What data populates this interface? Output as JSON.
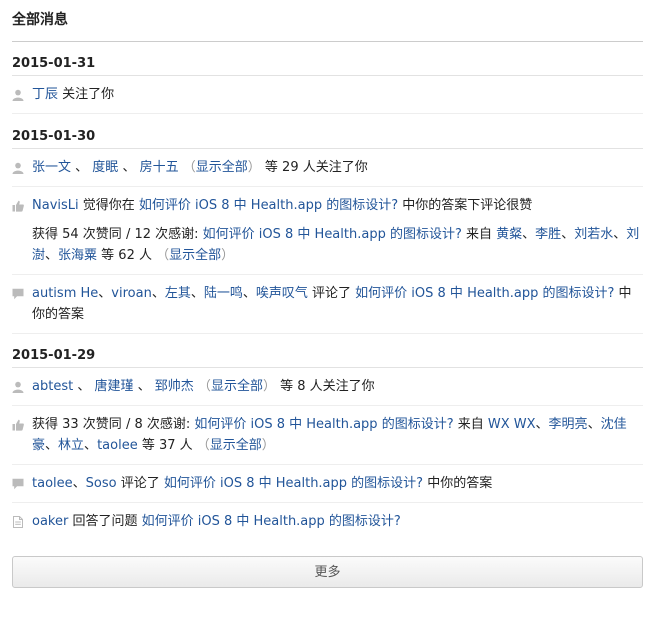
{
  "header": {
    "title": "全部消息"
  },
  "groups": {
    "g1": {
      "date": "2015-01-31",
      "item1": {
        "user": "丁辰",
        "action": " 关注了你"
      }
    },
    "g2": {
      "date": "2015-01-30",
      "item1": {
        "u1": "张一文",
        "sep1": " 、",
        "u2": "度眠",
        "sep2": " 、",
        "u3": "房十五",
        "show_all": "显示全部",
        "rest": " 等 29 人关注了你"
      },
      "item2": {
        "user": "NavisLi",
        "t1": " 觉得你在 ",
        "question": "如何评价 iOS 8 中 Health.app 的图标设计?",
        "t2": "  中你的答案下评论很赞"
      },
      "item3": {
        "t1": "获得 54 次赞同 / 12 次感谢: ",
        "question": "如何评价 iOS 8 中 Health.app 的图标设计?",
        "t2": "  来自 ",
        "u1": "黄粲",
        "u2": "李胜",
        "u3": "刘若水",
        "u4": "刘澍",
        "u5": "张海粟",
        "sep": "、",
        "t3": " 等 62 人 ",
        "show_all": "显示全部"
      },
      "item4": {
        "u1": "autism He",
        "u2": "viroan",
        "u3": "左其",
        "u4": "陆一鸣",
        "u5": "唉声叹气",
        "sep": "、",
        "t1": " 评论了 ",
        "question": "如何评价 iOS 8 中 Health.app 的图标设计?",
        "t2": "  中你的答案"
      }
    },
    "g3": {
      "date": "2015-01-29",
      "item1": {
        "u1": "abtest",
        "sep1": " 、",
        "u2": "唐建瑾",
        "sep2": " 、",
        "u3": "郅帅杰",
        "show_all": "显示全部",
        "rest": " 等 8 人关注了你"
      },
      "item2": {
        "t1": "获得 33 次赞同 / 8 次感谢: ",
        "question": "如何评价 iOS 8 中 Health.app 的图标设计?",
        "t2": "  来自 ",
        "u1": "WX WX",
        "u2": "李明亮",
        "u3": "沈佳豪",
        "u4": "林立",
        "u5": "taolee",
        "sep": "、",
        "t3": " 等 37 人 ",
        "show_all": "显示全部"
      },
      "item3": {
        "u1": "taolee",
        "u2": "Soso",
        "sep": "、",
        "t1": " 评论了 ",
        "question": "如何评价 iOS 8 中 Health.app 的图标设计?",
        "t2": "  中你的答案"
      },
      "item4": {
        "user": "oaker",
        "t1": " 回答了问题 ",
        "question": "如何评价 iOS 8 中 Health.app 的图标设计?"
      }
    }
  },
  "paren_open": "（",
  "paren_close": "）",
  "more_button": {
    "label": "更多"
  },
  "icons": {
    "user": "user-icon",
    "thumb": "thumbs-up-icon",
    "comment": "comment-icon",
    "doc": "document-icon"
  },
  "colors": {
    "link": "#225599",
    "icon": "#bbbbbb",
    "muted": "#999999"
  }
}
